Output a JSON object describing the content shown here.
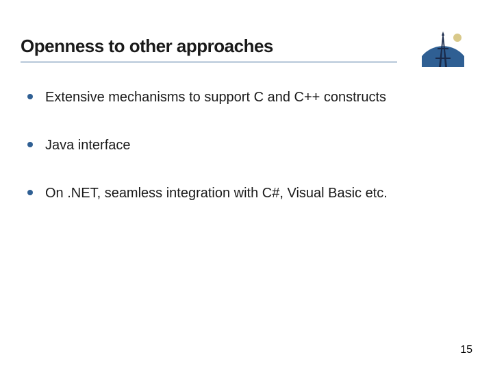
{
  "title": "Openness to other approaches",
  "bullets": [
    "Extensive mechanisms to support C and C++ constructs",
    "Java interface",
    "On .NET, seamless integration with C#, Visual Basic etc."
  ],
  "page_number": "15",
  "colors": {
    "accent": "#2f5f93"
  }
}
